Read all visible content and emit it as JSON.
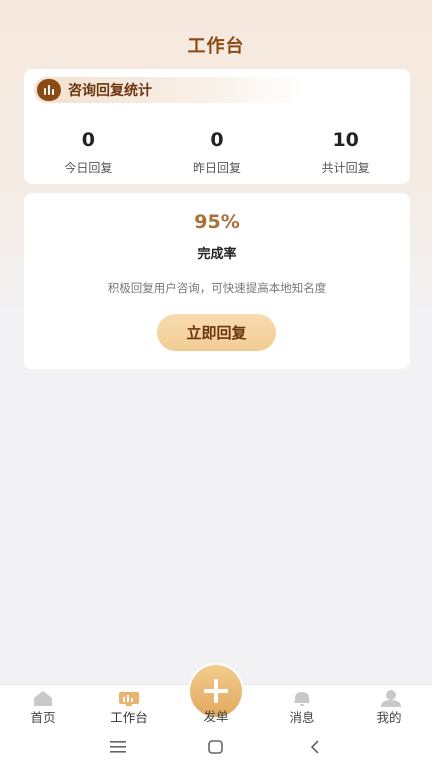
{
  "header": {
    "title": "工作台"
  },
  "stats_card": {
    "title": "咨询回复统计",
    "icon": "bar-chart-icon",
    "stats": [
      {
        "value": "0",
        "label": "今日回复"
      },
      {
        "value": "0",
        "label": "昨日回复"
      },
      {
        "value": "10",
        "label": "共计回复"
      }
    ]
  },
  "rate_card": {
    "value": "95%",
    "label": "完成率",
    "description": "积极回复用户咨询，可快速提高本地知名度",
    "button_label": "立即回复"
  },
  "tabbar": {
    "items": [
      {
        "label": "首页",
        "icon": "home-icon"
      },
      {
        "label": "工作台",
        "icon": "dashboard-icon"
      },
      {
        "label": "发单",
        "icon": "plus-icon"
      },
      {
        "label": "消息",
        "icon": "bell-icon"
      },
      {
        "label": "我的",
        "icon": "user-icon"
      }
    ]
  },
  "colors": {
    "brand": "#8a4b16",
    "accent": "#f2cc94",
    "rate": "#a8703a"
  }
}
